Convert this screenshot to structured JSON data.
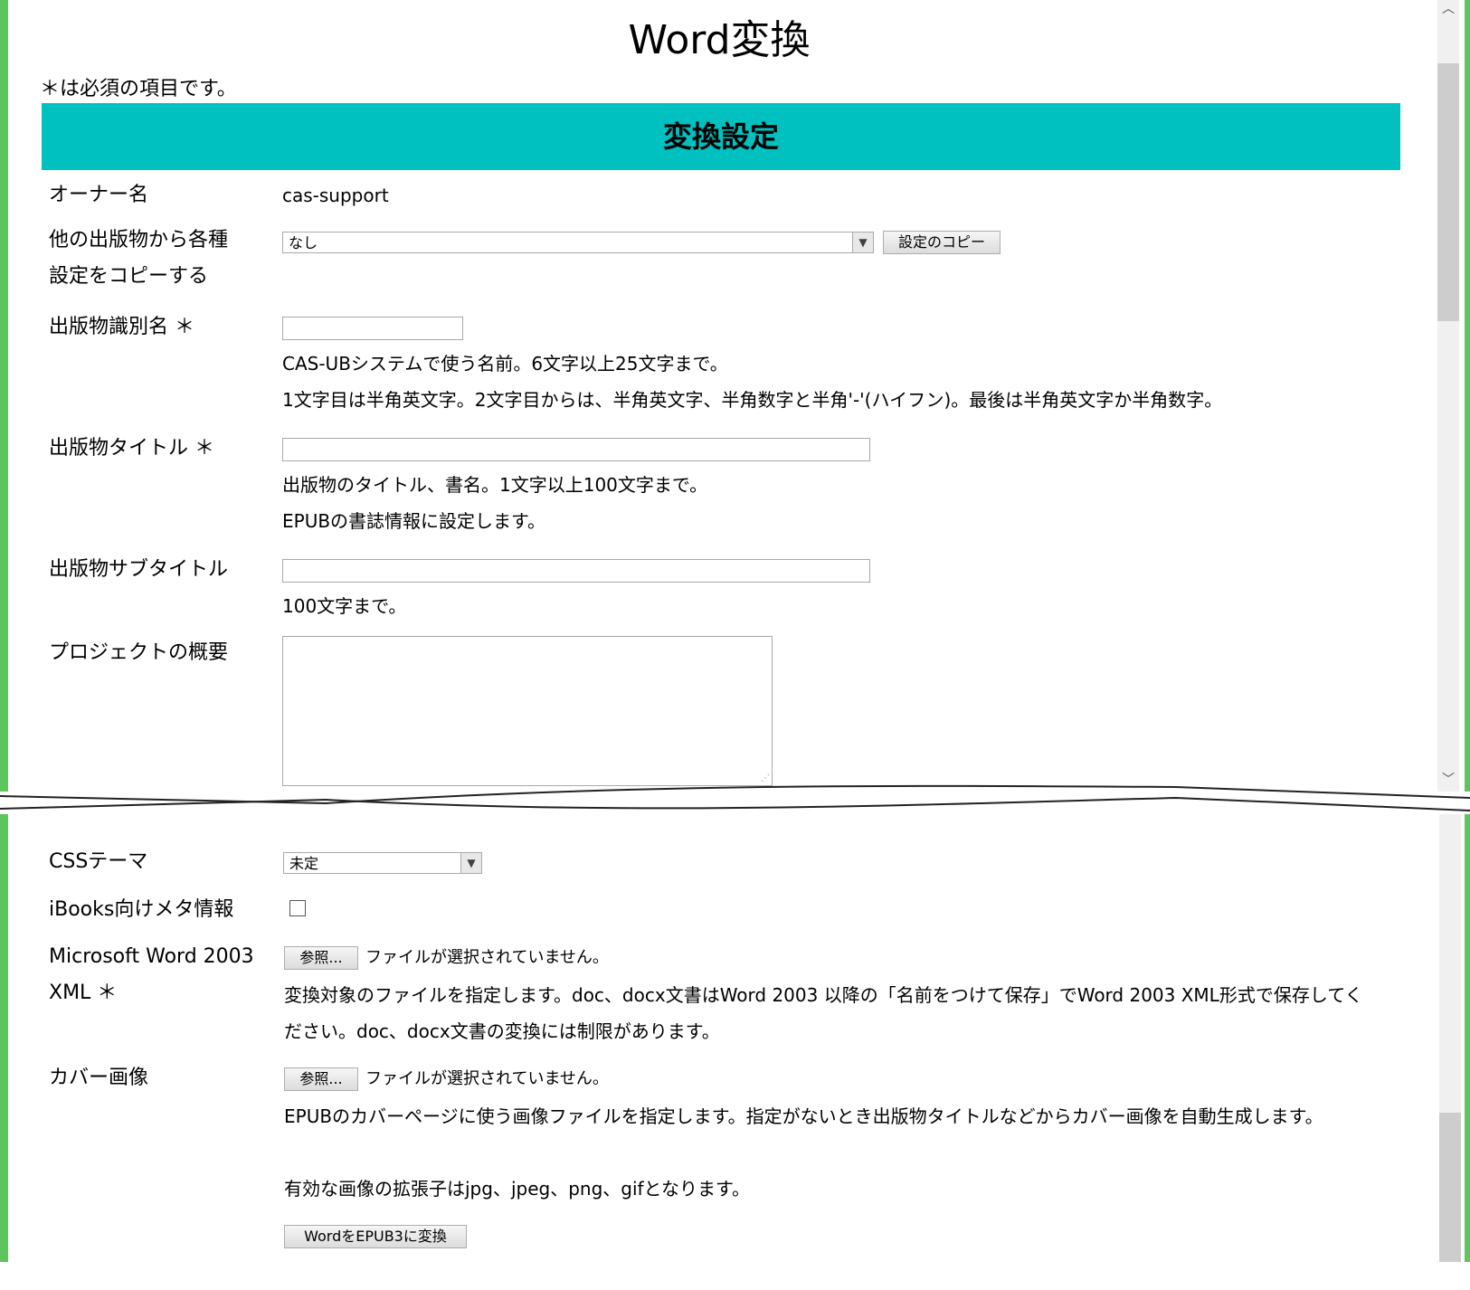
{
  "page": {
    "title": "Word変換",
    "required_note": "＊は必須の項目です。",
    "section_title": "変換設定"
  },
  "owner": {
    "label": "オーナー名",
    "value": "cas-support"
  },
  "copy_settings": {
    "label_line1": "他の出版物から各種",
    "label_line2": "設定をコピーする",
    "selected": "なし",
    "button": "設定のコピー"
  },
  "identifier": {
    "label": "出版物識別名 ＊",
    "value": "",
    "help_line1": "CAS-UBシステムで使う名前。6文字以上25文字まで。",
    "help_line2": "1文字目は半角英文字。2文字目からは、半角英文字、半角数字と半角'-'(ハイフン)。最後は半角英文字か半角数字。"
  },
  "title_field": {
    "label": "出版物タイトル ＊",
    "value": "",
    "help_line1": "出版物のタイトル、書名。1文字以上100文字まで。",
    "help_line2": "EPUBの書誌情報に設定します。"
  },
  "subtitle": {
    "label": "出版物サブタイトル",
    "value": "",
    "help": "100文字まで。"
  },
  "summary": {
    "label": "プロジェクトの概要",
    "value": ""
  },
  "css_theme": {
    "label": "CSSテーマ",
    "selected": "未定"
  },
  "ibooks": {
    "label": "iBooks向けメタ情報",
    "checked": false
  },
  "word_xml": {
    "label_line1": "Microsoft Word 2003",
    "label_line2": "XML ＊",
    "browse": "参照...",
    "status": "ファイルが選択されていません。",
    "help": "変換対象のファイルを指定します。doc、docx文書はWord 2003 以降の「名前をつけて保存」でWord 2003 XML形式で保存してください。doc、docx文書の変換には制限があります。"
  },
  "cover": {
    "label": "カバー画像",
    "browse": "参照...",
    "status": "ファイルが選択されていません。",
    "help": "EPUBのカバーページに使う画像ファイルを指定します。指定がないとき出版物タイトルなどからカバー画像を自動生成します。",
    "help_ext": "有効な画像の拡張子はjpg、jpeg、png、gifとなります。"
  },
  "submit": {
    "label": "WordをEPUB3に変換"
  }
}
